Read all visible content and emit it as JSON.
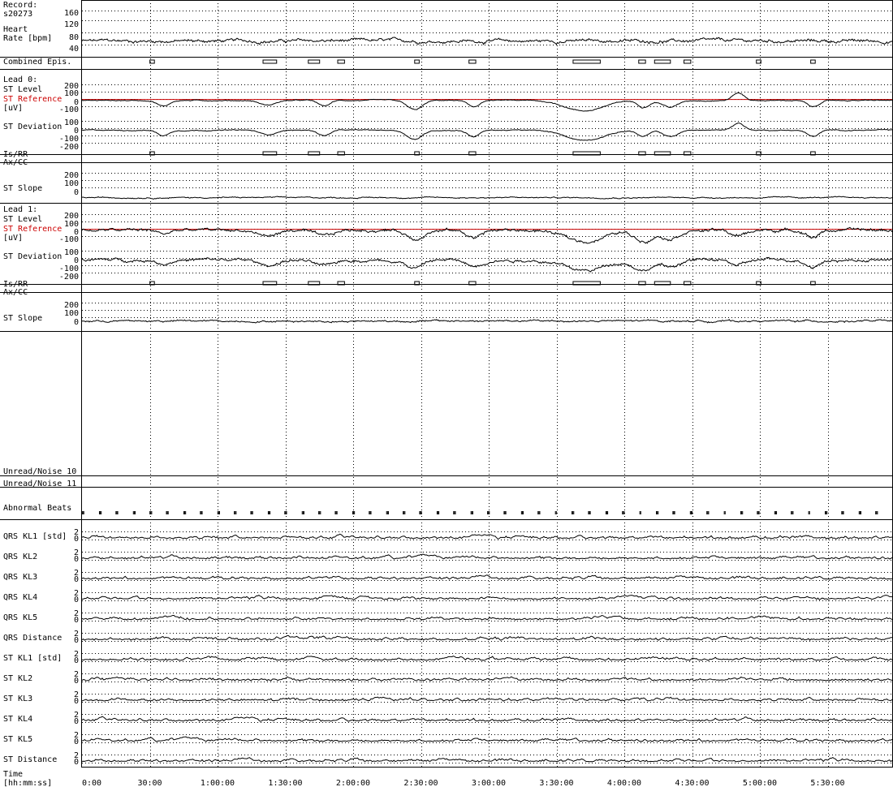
{
  "record": {
    "label": "Record:",
    "id": "s20273"
  },
  "colors": {
    "trace": "#000000",
    "reference": "#cc0000",
    "grid": "#000000"
  },
  "time_axis": {
    "label_line1": "Time",
    "label_line2": "[hh:mm:ss]",
    "ticks": [
      "0:00",
      "30:00",
      "1:00:00",
      "1:30:00",
      "2:00:00",
      "2:30:00",
      "3:00:00",
      "3:30:00",
      "4:00:00",
      "4:30:00",
      "5:00:00",
      "5:30:00"
    ]
  },
  "heart_rate": {
    "label_line1": "Heart",
    "label_line2": "Rate [bpm]",
    "ticks": [
      "160",
      "120",
      "80",
      "40"
    ]
  },
  "combined_episodes": {
    "label": "Combined Epis."
  },
  "leads": [
    {
      "title": "Lead 0:",
      "st_level": "ST Level",
      "st_reference": "ST Reference",
      "unit": "[uV]",
      "level_ticks": [
        "200",
        "100",
        "0",
        "-100"
      ],
      "st_deviation": "ST Deviation",
      "deviation_ticks": [
        "100",
        "0",
        "-100",
        "-200"
      ],
      "isrr": "Is/RR",
      "axcc": "Ax/CC",
      "st_slope": "ST Slope",
      "slope_ticks": [
        "200",
        "100",
        "0"
      ]
    },
    {
      "title": "Lead 1:",
      "st_level": "ST Level",
      "st_reference": "ST Reference",
      "unit": "[uV]",
      "level_ticks": [
        "200",
        "100",
        "0",
        "-100"
      ],
      "st_deviation": "ST Deviation",
      "deviation_ticks": [
        "100",
        "0",
        "-100",
        "-200"
      ],
      "isrr": "Is/RR",
      "axcc": "Ax/CC",
      "st_slope": "ST Slope",
      "slope_ticks": [
        "200",
        "100",
        "0"
      ]
    }
  ],
  "unread_noise": [
    "Unread/Noise 10",
    "Unread/Noise 11"
  ],
  "abnormal_beats": {
    "label": "Abnormal Beats"
  },
  "kl_rows": [
    {
      "label": "QRS KL1 [std]",
      "ticks": [
        "2",
        "0"
      ]
    },
    {
      "label": "QRS KL2",
      "ticks": [
        "2",
        "0"
      ]
    },
    {
      "label": "QRS KL3",
      "ticks": [
        "2",
        "0"
      ]
    },
    {
      "label": "QRS KL4",
      "ticks": [
        "2",
        "0"
      ]
    },
    {
      "label": "QRS KL5",
      "ticks": [
        "2",
        "0"
      ]
    },
    {
      "label": "QRS Distance",
      "ticks": [
        "2",
        "0"
      ]
    },
    {
      "label": "ST KL1 [std]",
      "ticks": [
        "2",
        "0"
      ]
    },
    {
      "label": "ST KL2",
      "ticks": [
        "2",
        "0"
      ]
    },
    {
      "label": "ST KL3",
      "ticks": [
        "2",
        "0"
      ]
    },
    {
      "label": "ST KL4",
      "ticks": [
        "2",
        "0"
      ]
    },
    {
      "label": "ST KL5",
      "ticks": [
        "2",
        "0"
      ]
    },
    {
      "label": "ST Distance",
      "ticks": [
        "2",
        "0"
      ]
    }
  ],
  "chart_data": {
    "type": "line",
    "x_unit": "hh:mm:ss",
    "xlim": [
      "0:00",
      "5:58:00"
    ],
    "ischemic_episodes_hhmm": [
      [
        "0:30",
        "0:32"
      ],
      [
        "1:20",
        "1:26"
      ],
      [
        "1:40",
        "1:45"
      ],
      [
        "1:53",
        "1:56"
      ],
      [
        "2:27",
        "2:29"
      ],
      [
        "2:51",
        "2:54"
      ],
      [
        "3:37",
        "3:49"
      ],
      [
        "4:06",
        "4:09"
      ],
      [
        "4:13",
        "4:20"
      ],
      [
        "4:26",
        "4:29"
      ],
      [
        "4:58",
        "5:00"
      ],
      [
        "5:22",
        "5:24"
      ]
    ],
    "panels": [
      {
        "name": "Heart Rate [bpm]",
        "ylim": [
          40,
          170
        ],
        "baseline": 75,
        "noise": 6,
        "dips": []
      },
      {
        "name": "Lead 0 ST Level [uV]",
        "ylim": [
          -150,
          230
        ],
        "baseline": -10,
        "noise": 8,
        "reference": 0,
        "dips": [
          [
            "0:36",
            -60,
            6
          ],
          [
            "1:22",
            -50,
            8
          ],
          [
            "1:47",
            -60,
            6
          ],
          [
            "2:27",
            -100,
            8
          ],
          [
            "2:53",
            -70,
            6
          ],
          [
            "3:42",
            -110,
            20
          ],
          [
            "4:08",
            -70,
            6
          ],
          [
            "4:20",
            -70,
            8
          ],
          [
            "4:50",
            80,
            6
          ],
          [
            "5:23",
            -70,
            6
          ]
        ]
      },
      {
        "name": "Lead 0 ST Deviation [uV]",
        "ylim": [
          -230,
          130
        ],
        "baseline": 0,
        "noise": 8,
        "dips": [
          [
            "0:36",
            -60,
            6
          ],
          [
            "1:22",
            -50,
            8
          ],
          [
            "1:47",
            -60,
            6
          ],
          [
            "2:27",
            -100,
            8
          ],
          [
            "2:53",
            -70,
            6
          ],
          [
            "3:42",
            -110,
            20
          ],
          [
            "4:08",
            -70,
            6
          ],
          [
            "4:20",
            -70,
            8
          ],
          [
            "4:50",
            80,
            6
          ],
          [
            "5:23",
            -70,
            6
          ]
        ]
      },
      {
        "name": "Lead 0 ST Slope",
        "ylim": [
          -20,
          230
        ],
        "baseline": 5,
        "noise": 6,
        "dips": []
      },
      {
        "name": "Lead 1 ST Level [uV]",
        "ylim": [
          -150,
          230
        ],
        "baseline": -10,
        "noise": 25,
        "reference": 0,
        "dips": [
          [
            "0:36",
            -40,
            6
          ],
          [
            "1:22",
            -60,
            10
          ],
          [
            "1:47",
            -70,
            10
          ],
          [
            "2:27",
            -90,
            8
          ],
          [
            "2:53",
            -70,
            8
          ],
          [
            "3:42",
            -120,
            20
          ],
          [
            "4:08",
            -110,
            10
          ],
          [
            "4:20",
            -80,
            8
          ],
          [
            "4:50",
            -60,
            8
          ],
          [
            "5:23",
            -70,
            6
          ]
        ]
      },
      {
        "name": "Lead 1 ST Deviation [uV]",
        "ylim": [
          -230,
          130
        ],
        "baseline": 0,
        "noise": 25,
        "dips": [
          [
            "0:36",
            -40,
            6
          ],
          [
            "1:22",
            -60,
            10
          ],
          [
            "1:47",
            -70,
            10
          ],
          [
            "2:27",
            -90,
            8
          ],
          [
            "2:53",
            -70,
            8
          ],
          [
            "3:42",
            -120,
            20
          ],
          [
            "4:08",
            -110,
            10
          ],
          [
            "4:20",
            -80,
            8
          ],
          [
            "4:50",
            -60,
            8
          ],
          [
            "5:23",
            -70,
            6
          ]
        ]
      },
      {
        "name": "Lead 1 ST Slope",
        "ylim": [
          -20,
          230
        ],
        "baseline": 40,
        "noise": 10,
        "dips": []
      }
    ],
    "kl_ylim": [
      -0.3,
      2.6
    ]
  }
}
